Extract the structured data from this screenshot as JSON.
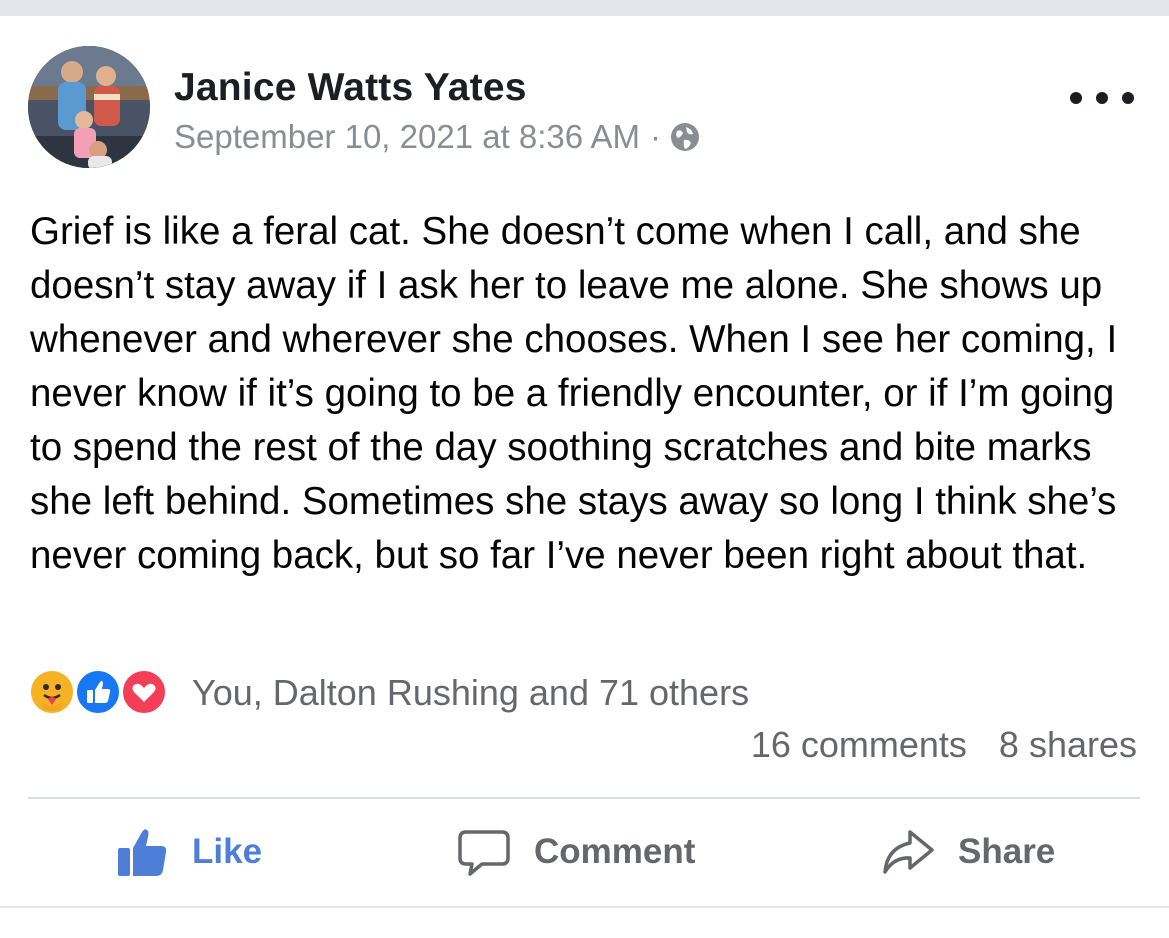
{
  "post": {
    "author": "Janice Watts Yates",
    "timestamp": "September 10, 2021 at 8:36 AM",
    "separator": "·",
    "privacy_icon": "globe-icon",
    "menu_icon": "more-options-icon",
    "text": "Grief is like a feral cat. She doesn’t come when I call, and she doesn’t stay away if I ask her to leave me alone. She shows up whenever and wherever she chooses. When I see her coming, I never know if it’s going to be a friendly encounter, or if I’m going to spend the rest of the day soothing scratches and bite marks she left behind. Sometimes she stays away so long I think she’s never coming back, but so far I’ve never been right about that."
  },
  "reactions": {
    "icons": [
      "care-reaction-icon",
      "like-reaction-icon",
      "love-reaction-icon"
    ],
    "summary": "You, Dalton Rushing and 71 others",
    "comments": "16 comments",
    "shares": "8 shares"
  },
  "actions": {
    "like": "Like",
    "comment": "Comment",
    "share": "Share"
  },
  "colors": {
    "like_blue": "#4e7fd6",
    "love_red": "#f33e58",
    "care_yellow": "#f7b125",
    "secondary_text": "#65676b",
    "meta_text": "#8a8d91"
  }
}
